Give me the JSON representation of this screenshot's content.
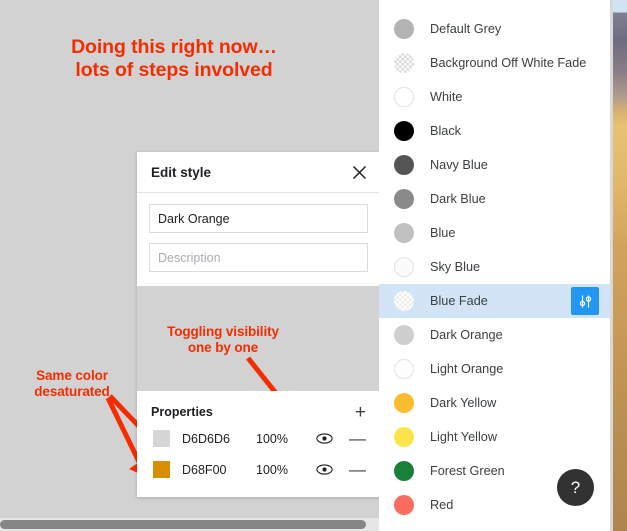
{
  "annotations": {
    "top": "Doing this right now…\nlots of steps involved",
    "toggle_visibility": "Toggling visibility\none by one",
    "same_color": "Same color\ndesaturated",
    "color": "#f42d00"
  },
  "dialog": {
    "title": "Edit style",
    "close_icon": "close-icon",
    "name_value": "Dark Orange",
    "description_placeholder": "Description",
    "properties": {
      "label": "Properties",
      "add_label": "+",
      "rows": [
        {
          "swatch": "#d6d6d6",
          "hex": "D6D6D6",
          "opacity": "100%",
          "eye_icon": "eye-icon",
          "remove_label": "—"
        },
        {
          "swatch": "#d68f00",
          "hex": "D68F00",
          "opacity": "100%",
          "eye_icon": "eye-icon",
          "remove_label": "—"
        }
      ]
    }
  },
  "styles_panel": {
    "selected_index": 8,
    "tune_button_icon": "tune-sliders-icon",
    "tune_button_color": "#2196f3",
    "selected_row_color": "#d2e5f7",
    "items": [
      {
        "label": "Default Grey",
        "color": "#b4b4b4",
        "kind": "solid"
      },
      {
        "label": "Background Off White Fade",
        "color": "#ffffff",
        "kind": "checker"
      },
      {
        "label": "White",
        "color": "#ffffff",
        "kind": "outline"
      },
      {
        "label": "Black",
        "color": "#000000",
        "kind": "solid"
      },
      {
        "label": "Navy Blue",
        "color": "#555555",
        "kind": "solid"
      },
      {
        "label": "Dark Blue",
        "color": "#8a8a8a",
        "kind": "solid"
      },
      {
        "label": "Blue",
        "color": "#c0c0c0",
        "kind": "solid"
      },
      {
        "label": "Sky Blue",
        "color": "#fbfbfb",
        "kind": "outline"
      },
      {
        "label": "Blue Fade",
        "color": "#ffffff",
        "kind": "checker-faint"
      },
      {
        "label": "Dark Orange",
        "color": "#cfcfcf",
        "kind": "solid"
      },
      {
        "label": "Light Orange",
        "color": "#fdfdfd",
        "kind": "outline"
      },
      {
        "label": "Dark Yellow",
        "color": "#fbbc2e",
        "kind": "solid"
      },
      {
        "label": "Light Yellow",
        "color": "#fbe54b",
        "kind": "solid"
      },
      {
        "label": "Forest Green",
        "color": "#188038",
        "kind": "solid"
      },
      {
        "label": "Red",
        "color": "#f96c5f",
        "kind": "solid"
      }
    ]
  },
  "help_button": {
    "label": "?",
    "icon": "question-mark-icon"
  },
  "scrollbar": {
    "orientation": "horizontal"
  }
}
